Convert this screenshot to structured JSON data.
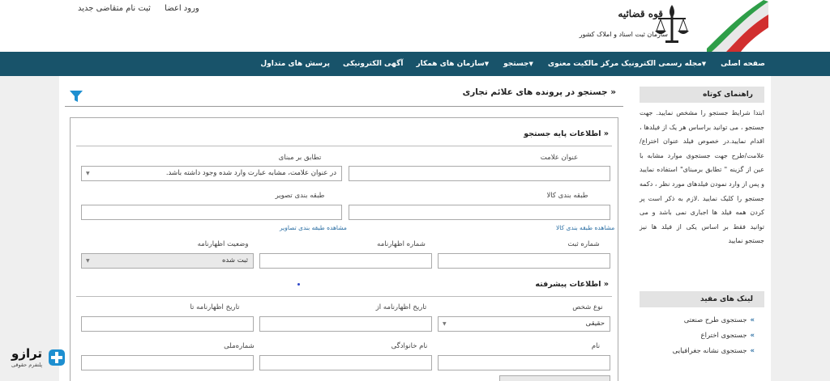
{
  "header": {
    "org_title": "قوه قضائیه",
    "org_subtitle": "سازمان ثبت اسناد و املاک کشور",
    "login_link": "ورود اعضا",
    "register_link": "ثبت نام متقاضی جدید"
  },
  "nav": {
    "items": [
      {
        "label": "صفحه اصلی",
        "caret": false
      },
      {
        "label": "مجله رسمی الکترونیک مرکز مالکیت معنوی",
        "caret": true
      },
      {
        "label": "جستجو",
        "caret": true
      },
      {
        "label": "سازمان های همکار",
        "caret": true
      },
      {
        "label": "آگهی الکترونیکی",
        "caret": false
      },
      {
        "label": "پرسش های متداول",
        "caret": false
      }
    ]
  },
  "page": {
    "title": "جستجو در پرونده های علائم تجاری",
    "title_chevron": "«"
  },
  "basic": {
    "heading": "اطلاعات پایه جستجو",
    "mark_title_label": "عنوان علامت",
    "match_label": "تطابق بر مبنای",
    "match_value": "در عنوان علامت، مشابه عبارت وارد شده وجود داشته باشد.",
    "goods_class_label": "طبقه بندی کالا",
    "image_class_label": "طبقه بندی تصویر",
    "goods_class_link": "مشاهده طبقه بندی کالا",
    "image_class_link": "مشاهده طبقه بندی تصاویر",
    "reg_number_label": "شماره ثبت",
    "declaration_number_label": "شماره اظهارنامه",
    "declaration_status_label": "وضعیت اظهارنامه",
    "declaration_status_value": "ثبت شده"
  },
  "advanced": {
    "heading": "اطلاعات پیشرفته",
    "person_type_label": "نوع شخص",
    "person_type_value": "حقیقی",
    "date_from_label": "تاریخ اظهارنامه از",
    "date_to_label": "تاریخ اظهارنامه تا",
    "name_label": "نام",
    "family_label": "نام خانوادگی",
    "national_id_label": "شماره‌ملی"
  },
  "sidebar": {
    "guide_heading": "راهنمای کوتاه",
    "guide_text": "ابتدا شرایط جستجو را مشخص نمایید. جهت جستجو ، می توانید براساس هر یک از فیلدها ، اقدام نمایید.در خصوص فیلد عنوان اختراع/علامت/طرح جهت جستجوی موارد مشابه با عین از گزینه \" تطابق برمبنای\" استفاده نمایید و پس از وارد نمودن فیلدهای مورد نظر ، دکمه جستجو را کلیک نمایید .لازم به ذکر است پر کردن همه فیلد ها اجباری نمی باشد و می توانید فقط بر اساس یکی از فیلد ها نیز جستجو نمایید",
    "links_heading": "لینک های مفید",
    "links": [
      "جستجوی طرح صنعتی",
      "جستجوی اختراع",
      "جستجوی نشانه جغرافیایی"
    ]
  },
  "watermark": {
    "name": "ترازو",
    "subtitle": "پلتفرم حقوقی"
  },
  "colors": {
    "navbar": "#18536a",
    "accent_blue": "#2a6ea3",
    "filter_icon": "#1e8fd0",
    "side_header_bg": "#e3e3e3"
  }
}
